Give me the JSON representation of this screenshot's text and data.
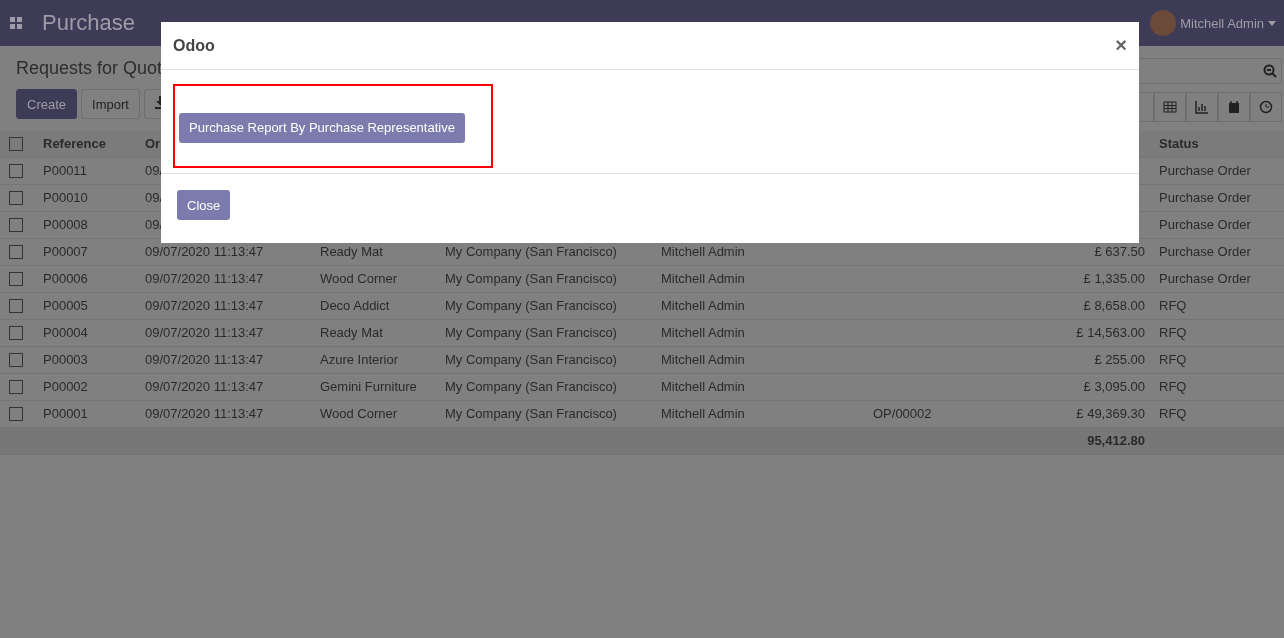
{
  "navbar": {
    "app_name": "Purchase",
    "user": "Mitchell Admin"
  },
  "control_panel": {
    "title": "Requests for Quot",
    "buttons": [
      "Create",
      "Import"
    ]
  },
  "table": {
    "select_all_checked": false,
    "columns": [
      "Reference",
      "Or",
      "Status"
    ],
    "rows": [
      {
        "checked": false,
        "reference": "P00011",
        "order_date": "09/",
        "status": "Purchase Order"
      },
      {
        "checked": false,
        "reference": "P00010",
        "order_date": "09/",
        "status": "Purchase Order"
      },
      {
        "checked": false,
        "reference": "P00008",
        "order_date": "09/",
        "status": "Purchase Order"
      },
      {
        "checked": false,
        "reference": "P00007",
        "order_date": "09/07/2020 11:13:47",
        "vendor": "Ready Mat",
        "company": "My Company (San Francisco)",
        "representative": "Mitchell Admin",
        "total": "£ 637.50",
        "status": "Purchase Order"
      },
      {
        "checked": false,
        "reference": "P00006",
        "order_date": "09/07/2020 11:13:47",
        "vendor": "Wood Corner",
        "company": "My Company (San Francisco)",
        "representative": "Mitchell Admin",
        "total": "£ 1,335.00",
        "status": "Purchase Order"
      },
      {
        "checked": false,
        "reference": "P00005",
        "order_date": "09/07/2020 11:13:47",
        "vendor": "Deco Addict",
        "company": "My Company (San Francisco)",
        "representative": "Mitchell Admin",
        "total": "£ 8,658.00",
        "status": "RFQ"
      },
      {
        "checked": false,
        "reference": "P00004",
        "order_date": "09/07/2020 11:13:47",
        "vendor": "Ready Mat",
        "company": "My Company (San Francisco)",
        "representative": "Mitchell Admin",
        "total": "£ 14,563.00",
        "status": "RFQ"
      },
      {
        "checked": false,
        "reference": "P00003",
        "order_date": "09/07/2020 11:13:47",
        "vendor": "Azure Interior",
        "company": "My Company (San Francisco)",
        "representative": "Mitchell Admin",
        "total": "£ 255.00",
        "status": "RFQ"
      },
      {
        "checked": false,
        "reference": "P00002",
        "order_date": "09/07/2020 11:13:47",
        "vendor": "Gemini Furniture",
        "company": "My Company (San Francisco)",
        "representative": "Mitchell Admin",
        "total": "£ 3,095.00",
        "status": "RFQ"
      },
      {
        "checked": false,
        "reference": "P00001",
        "order_date": "09/07/2020 11:13:47",
        "vendor": "Wood Corner",
        "company": "My Company (San Francisco)",
        "representative": "Mitchell Admin",
        "source": "OP/00002",
        "total": "£ 49,369.30",
        "status": "RFQ"
      }
    ],
    "grand_total": "95,412.80"
  },
  "dialog": {
    "title": "Odoo",
    "close_symbol": "×",
    "report_button": "Purchase Report By Purchase Representative",
    "footer_button": "Close"
  }
}
